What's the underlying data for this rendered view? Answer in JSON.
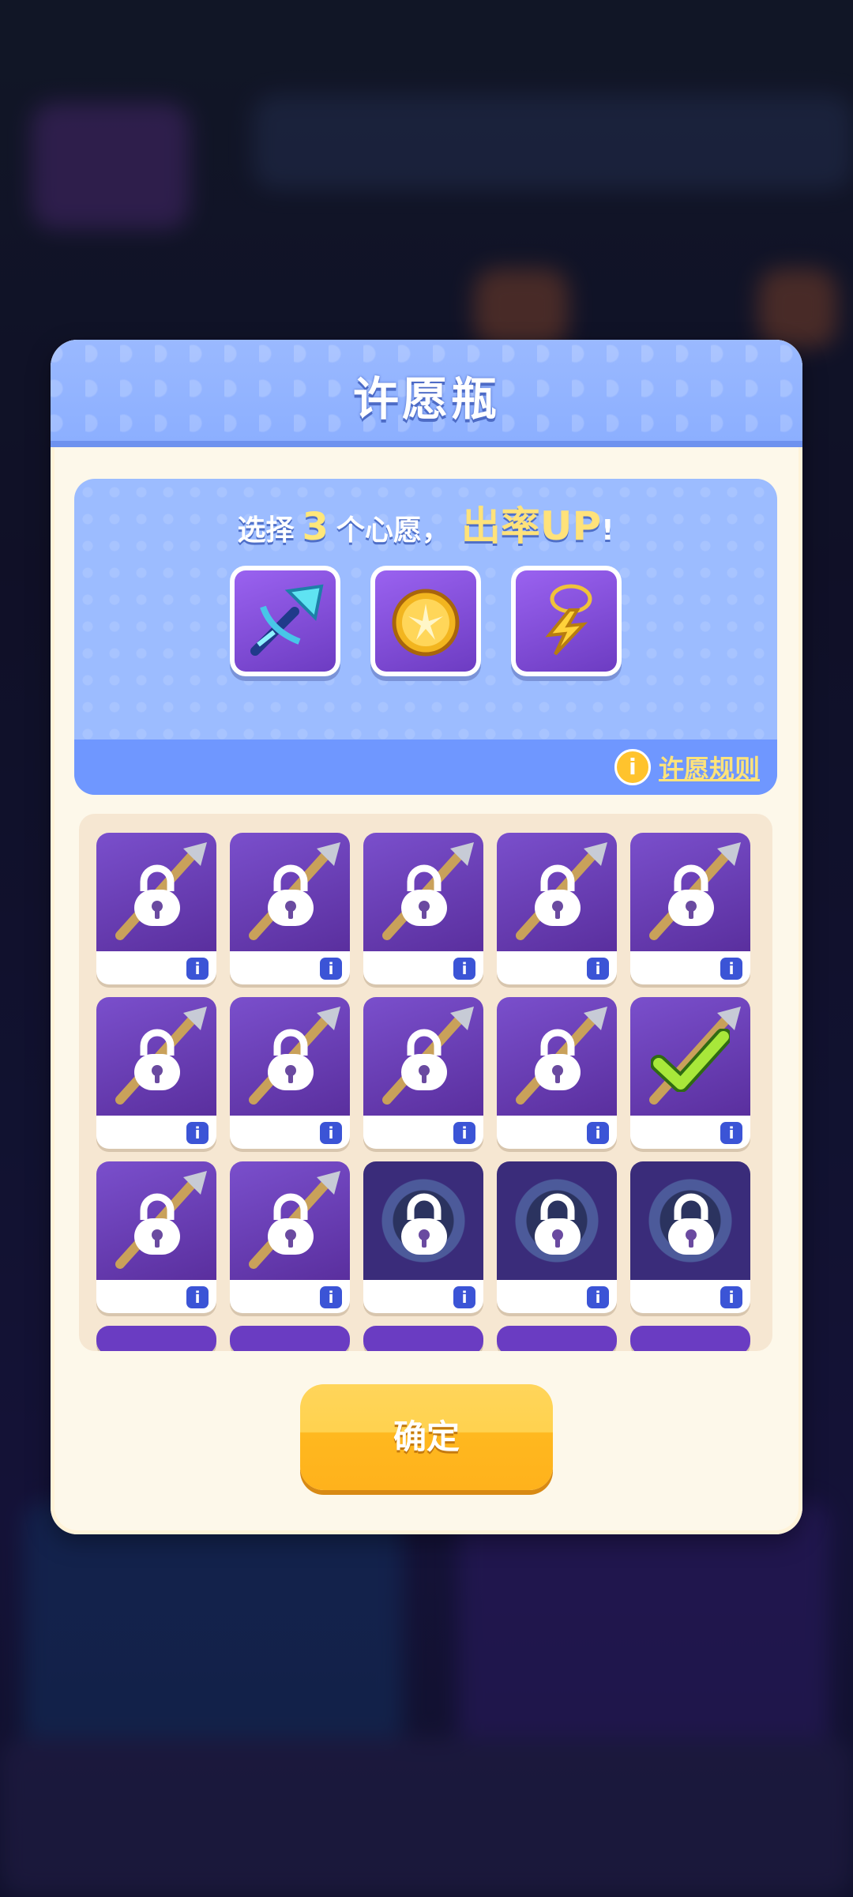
{
  "modal": {
    "title": "许愿瓶"
  },
  "wish": {
    "prefix": "选择",
    "count": "3",
    "middle": "个心愿，",
    "highlight": "出率UP",
    "suffix": "!",
    "rules_label": "许愿规则",
    "selected": [
      {
        "name": "crossbow-icon"
      },
      {
        "name": "golden-orb-icon"
      },
      {
        "name": "lightning-pendant-icon"
      }
    ]
  },
  "grid": {
    "rows": [
      [
        {
          "art": "weapon",
          "state": "locked",
          "icon": "lance-icon"
        },
        {
          "art": "weapon",
          "state": "locked",
          "icon": "golden-axe-icon"
        },
        {
          "art": "weapon",
          "state": "locked",
          "icon": "scythe-icon"
        },
        {
          "art": "weapon",
          "state": "locked",
          "icon": "club-icon"
        },
        {
          "art": "weapon",
          "state": "locked",
          "icon": "spear-icon"
        }
      ],
      [
        {
          "art": "weapon",
          "state": "locked",
          "icon": "dagger-icon"
        },
        {
          "art": "weapon",
          "state": "locked",
          "icon": "fire-bow-icon"
        },
        {
          "art": "weapon",
          "state": "locked",
          "icon": "dragon-blade-icon"
        },
        {
          "art": "weapon",
          "state": "locked",
          "icon": "golden-claw-icon"
        },
        {
          "art": "weapon",
          "state": "selected",
          "icon": "crossbow-icon"
        }
      ],
      [
        {
          "art": "weapon",
          "state": "locked",
          "icon": "bow-icon"
        },
        {
          "art": "weapon",
          "state": "locked",
          "icon": "hammer-icon"
        },
        {
          "art": "orb",
          "state": "locked",
          "icon": "dark-orb-icon"
        },
        {
          "art": "orb",
          "state": "locked",
          "icon": "dark-orb-icon"
        },
        {
          "art": "orb",
          "state": "locked",
          "icon": "dark-orb-icon"
        }
      ],
      [
        {
          "art": "partial-red",
          "state": "partial",
          "icon": "red-orb-icon"
        },
        {
          "art": "partial-red",
          "state": "partial",
          "icon": "red-orb-icon"
        },
        {
          "art": "partial-teal",
          "state": "partial",
          "icon": "teal-orb-icon"
        },
        {
          "art": "partial-teal",
          "state": "partial",
          "icon": "teal-orb-icon"
        },
        {
          "art": "partial-gold",
          "state": "partial",
          "icon": "gold-orb-icon"
        }
      ]
    ]
  },
  "confirm_label": "确定",
  "colors": {
    "header": "#8cafff",
    "panel": "#fdf8ea",
    "accent_gold": "#ffb81f",
    "card_purple": "#6a3cc2"
  }
}
